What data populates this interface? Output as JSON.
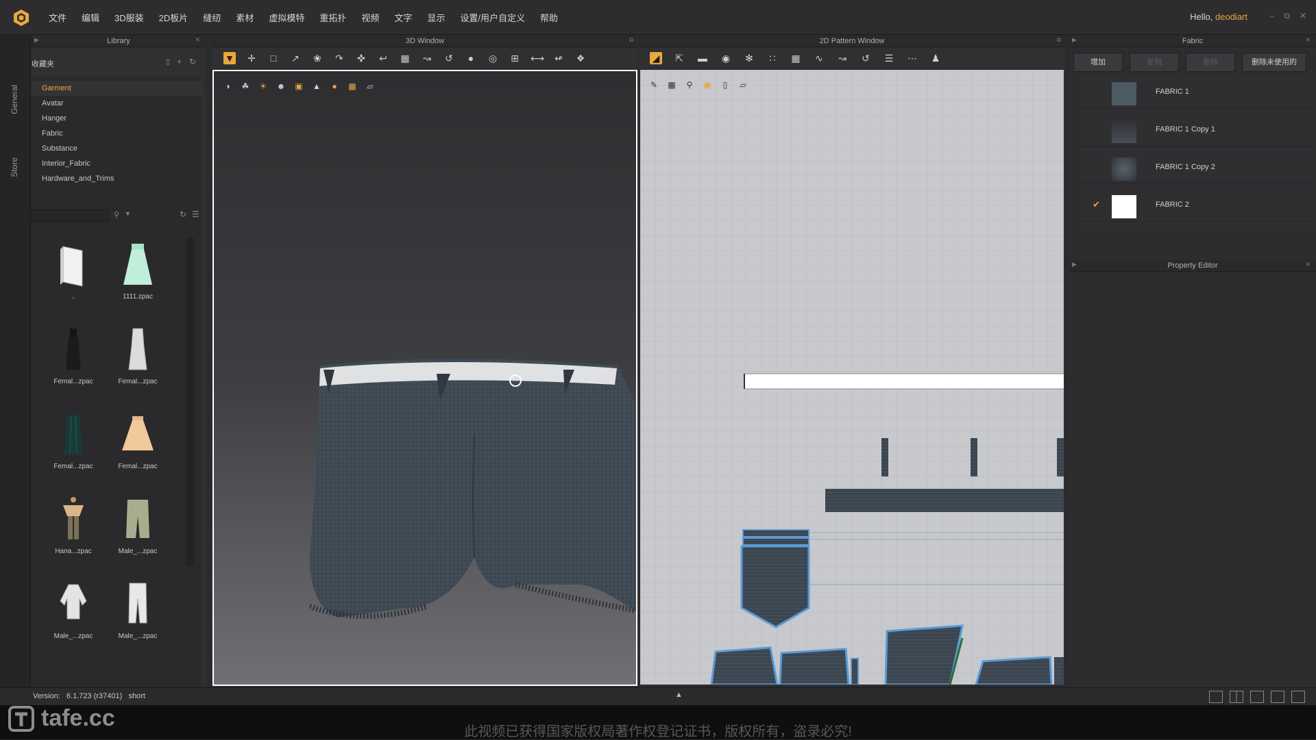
{
  "menu": {
    "items": [
      "文件",
      "编辑",
      "3D服装",
      "2D板片",
      "缝纫",
      "素材",
      "虚拟模特",
      "重拓扑",
      "视频",
      "文字",
      "显示",
      "设置/用户自定义",
      "帮助"
    ],
    "greeting": "Hello,",
    "user": "deodiart"
  },
  "side_tabs": {
    "general": "General",
    "store": "Store"
  },
  "library": {
    "title": "Library",
    "favorites_label": "收藏夹",
    "tree": [
      "Garment",
      "Avatar",
      "Hanger",
      "Fabric",
      "Substance",
      "Interior_Fabric",
      "Hardware_and_Trims"
    ],
    "thumbs": [
      "..",
      "1111.zpac",
      "Femal...zpac",
      "Femal...zpac",
      "Femal...zpac",
      "Femal...zpac",
      "Hana...zpac",
      "Male_...zpac",
      "Male_...zpac",
      "Male_...zpac"
    ]
  },
  "window3d": {
    "title": "3D Window"
  },
  "window2d": {
    "title": "2D Pattern Window"
  },
  "fabric": {
    "title": "Fabric",
    "buttons": {
      "add": "增加",
      "copy": "复制",
      "delete": "删除",
      "delete_unused": "删除未使用的"
    },
    "items": [
      {
        "name": "FABRIC 1",
        "color": "#4d5b63",
        "checked": false
      },
      {
        "name": "FABRIC 1 Copy 1",
        "color": "#3a3d42",
        "checked": false
      },
      {
        "name": "FABRIC 1 Copy 2",
        "color": "#454b52",
        "checked": false
      },
      {
        "name": "FABRIC 2",
        "color": "#ffffff",
        "checked": true
      }
    ]
  },
  "property_editor": {
    "title": "Property Editor"
  },
  "status": {
    "version_label": "Version:",
    "version": "6.1.723 (r37401)",
    "file": "short"
  },
  "watermark": {
    "brand": "tafe.cc",
    "notice": "此视频已获得国家版权局著作权登记证书，版权所有，盗录必究!"
  },
  "colors": {
    "accent": "#e9a83b",
    "fabric": "#3c4650"
  }
}
